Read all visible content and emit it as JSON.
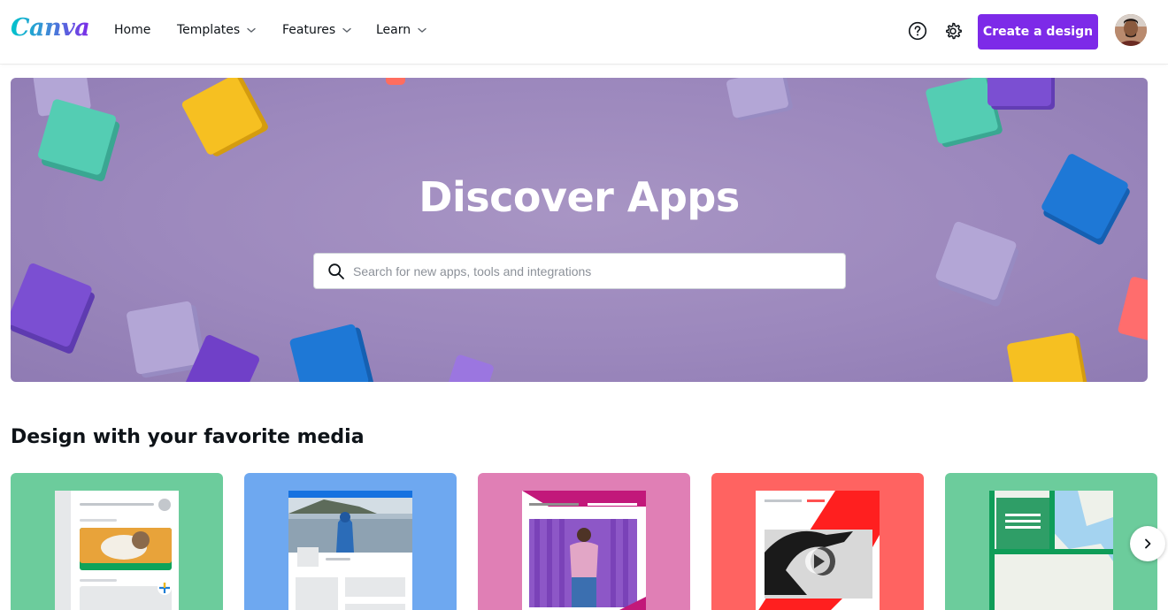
{
  "header": {
    "logo": "Canva",
    "nav": [
      {
        "label": "Home",
        "has_dropdown": false
      },
      {
        "label": "Templates",
        "has_dropdown": true
      },
      {
        "label": "Features",
        "has_dropdown": true
      },
      {
        "label": "Learn",
        "has_dropdown": true
      }
    ],
    "help_icon": "help-icon",
    "settings_icon": "gear-icon",
    "create_button": "Create a design",
    "brand_color": "#7d2ae8"
  },
  "hero": {
    "title": "Discover Apps",
    "search_placeholder": "Search for new apps, tools and integrations",
    "search_value": ""
  },
  "media_section": {
    "title": "Design with your favorite media",
    "cards": [
      {
        "kind": "photo-app",
        "color": "#6ccc9c"
      },
      {
        "kind": "image-post",
        "color": "#6ea8f0"
      },
      {
        "kind": "portrait-app",
        "color": "#e07fb5"
      },
      {
        "kind": "video-app",
        "color": "#ff6361"
      },
      {
        "kind": "map-app",
        "color": "#6ccc9c"
      }
    ],
    "next_icon": "chevron-right-icon"
  }
}
